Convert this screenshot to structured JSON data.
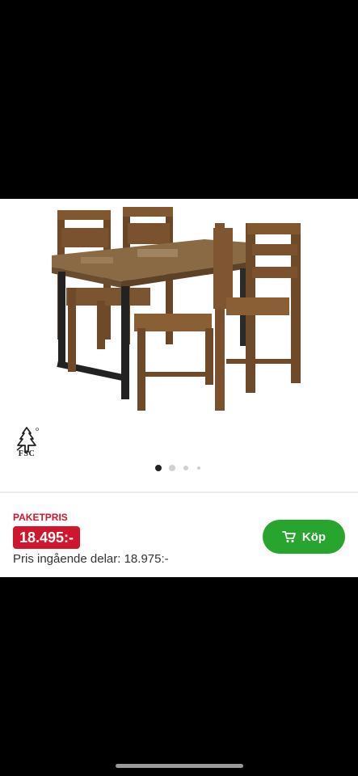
{
  "gallery": {
    "image_alt": "dining-table-with-four-chairs",
    "certification_icon": "fsc-tree-icon",
    "certification_label": "FSC",
    "carousel": {
      "total_dots": 4,
      "active_index": 0
    }
  },
  "price": {
    "package_label": "PAKETPRIS",
    "package_price": "18.495:-",
    "parts_price_text": "Pris ingående delar: 18.975:-"
  },
  "buy_button": {
    "label": "Köp",
    "icon": "cart-icon",
    "color": "#27a52f"
  },
  "colors": {
    "accent_red": "#d0162c",
    "background_bars": "#000000"
  }
}
